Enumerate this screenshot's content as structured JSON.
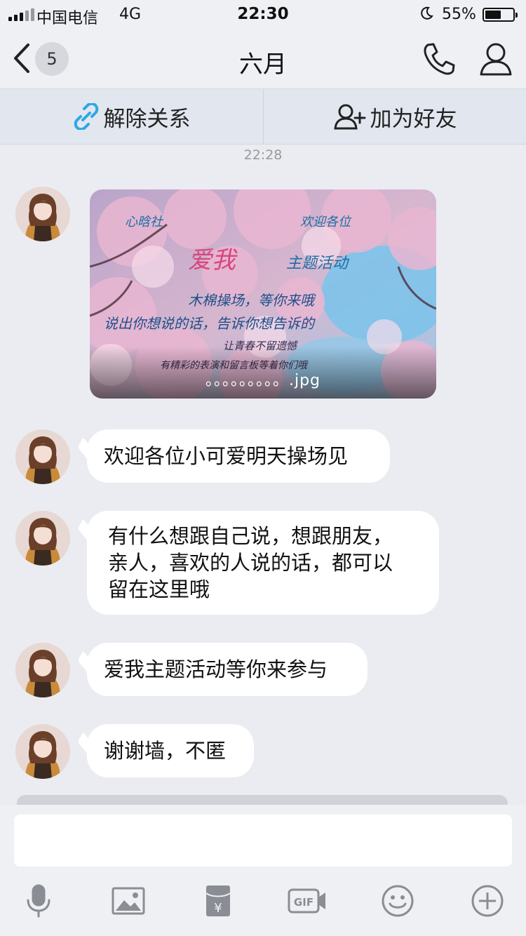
{
  "status_bar": {
    "carrier": "中国电信",
    "network": "4G",
    "time": "22:30",
    "battery": "55%"
  },
  "nav": {
    "unread_count": "5",
    "title": "六月",
    "icons": [
      "back-chevron-icon",
      "phone-icon",
      "profile-icon"
    ]
  },
  "actions": {
    "unlink_label": "解除关系",
    "add_friend_label": "加为好友"
  },
  "chat": {
    "timestamp": "22:28",
    "image_caption": "。。。。。。。。。.jpg",
    "messages": [
      {
        "text": "欢迎各位小可爱明天操场见"
      },
      {
        "text": "有什么想跟自己说，想跟朋友，\n亲人，喜欢的人说的话，都可以\n留在这里哦"
      },
      {
        "text": "爱我主题活动等你来参与"
      },
      {
        "text": "谢谢墙，不匿"
      }
    ]
  },
  "input": {
    "value": "",
    "placeholder": ""
  },
  "toolbar": {
    "icons": [
      "microphone-icon",
      "image-icon",
      "red-packet-icon",
      "gif-icon",
      "emoji-icon",
      "plus-icon"
    ]
  },
  "colors": {
    "background": "#ebecf1",
    "bar": "#eef0f4",
    "link_accent": "#2aa8e4",
    "bubble": "#ffffff"
  }
}
